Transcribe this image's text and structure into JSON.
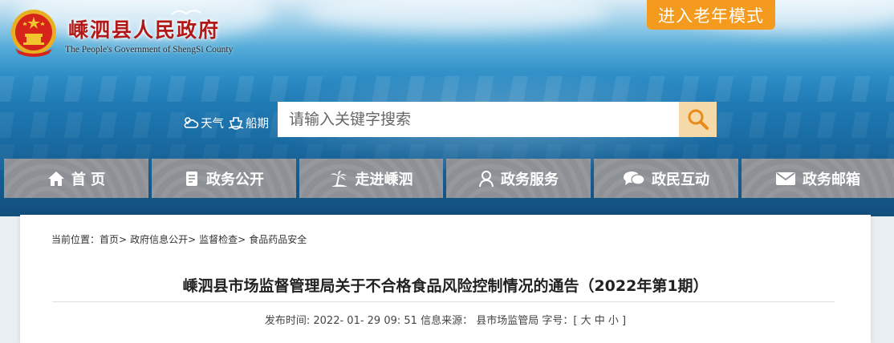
{
  "header": {
    "site_title": "嵊泗县人民政府",
    "site_subtitle": "The People's Government of ShengSi County",
    "elder_mode_label": "进入老年模式"
  },
  "quick_links": {
    "weather_label": "天气",
    "ferry_label": "船期"
  },
  "search": {
    "placeholder": "请输入关键字搜索"
  },
  "nav": {
    "items": [
      {
        "label": "首 页",
        "icon": "home-icon"
      },
      {
        "label": "政务公开",
        "icon": "document-icon"
      },
      {
        "label": "走进嵊泗",
        "icon": "palm-tree-icon"
      },
      {
        "label": "政务服务",
        "icon": "user-icon"
      },
      {
        "label": "政民互动",
        "icon": "chat-icon"
      },
      {
        "label": "政务邮箱",
        "icon": "mail-icon"
      }
    ]
  },
  "breadcrumb": {
    "prefix": "当前位置：",
    "items": [
      "首页>",
      "政府信息公开>",
      "监督检查>",
      "食品药品安全"
    ]
  },
  "article": {
    "title": "嵊泗县市场监督管理局关于不合格食品风险控制情况的通告（2022年第1期）",
    "publish_label": "发布时间: ",
    "publish_time": "2022- 01- 29 09: 51",
    "source_label": " 信息来源： ",
    "source": "县市场监管局",
    "font_size_label": " 字号：[ ",
    "font_large": "大",
    "font_medium": "中",
    "font_small": "小",
    "font_size_close": " ]"
  },
  "colors": {
    "title_red": "#b11818",
    "elder_orange": "#f39a1f",
    "nav_gray": "#8d9196"
  }
}
